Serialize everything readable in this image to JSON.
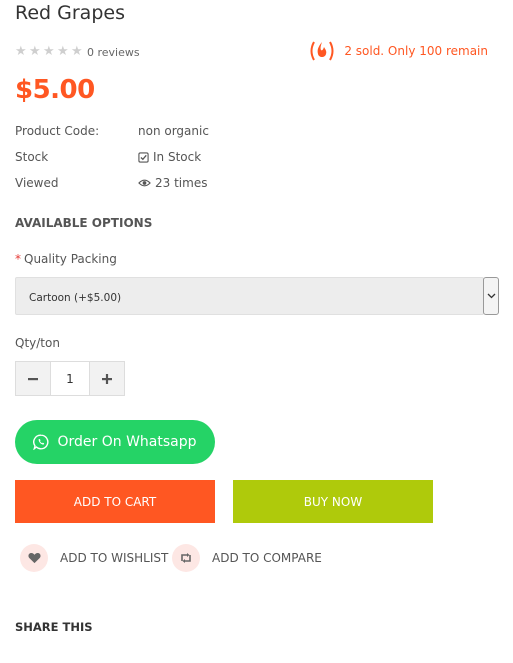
{
  "product": {
    "title": "Red Grapes",
    "reviews": "0 reviews",
    "sold_text": "2 sold. Only 100 remain",
    "price": "$5.00",
    "rating": 0,
    "rating_max": 5
  },
  "info": [
    {
      "key": "Product Code:",
      "value": "non organic",
      "icon": ""
    },
    {
      "key": "Stock",
      "value": "In Stock",
      "icon": "check-square-icon"
    },
    {
      "key": "Viewed",
      "value": "23 times",
      "icon": "eye-icon"
    }
  ],
  "options": {
    "heading": "AVAILABLE OPTIONS",
    "required_mark": "*",
    "label": "Quality Packing",
    "selected": "Cartoon (+$5.00)"
  },
  "quantity": {
    "label": "Qty/ton",
    "value": "1",
    "minus": "−",
    "plus": "+"
  },
  "buttons": {
    "whatsapp": "Order On Whatsapp",
    "add_to_cart": "ADD TO CART",
    "buy_now": "BUY NOW",
    "wishlist": "ADD TO WISHLIST",
    "compare": "ADD TO COMPARE"
  },
  "share": "SHARE THIS",
  "colors": {
    "accent": "#ff5722",
    "whatsapp": "#25d366",
    "buy_now": "#afca0b",
    "icon_bg": "#fde7e4"
  }
}
